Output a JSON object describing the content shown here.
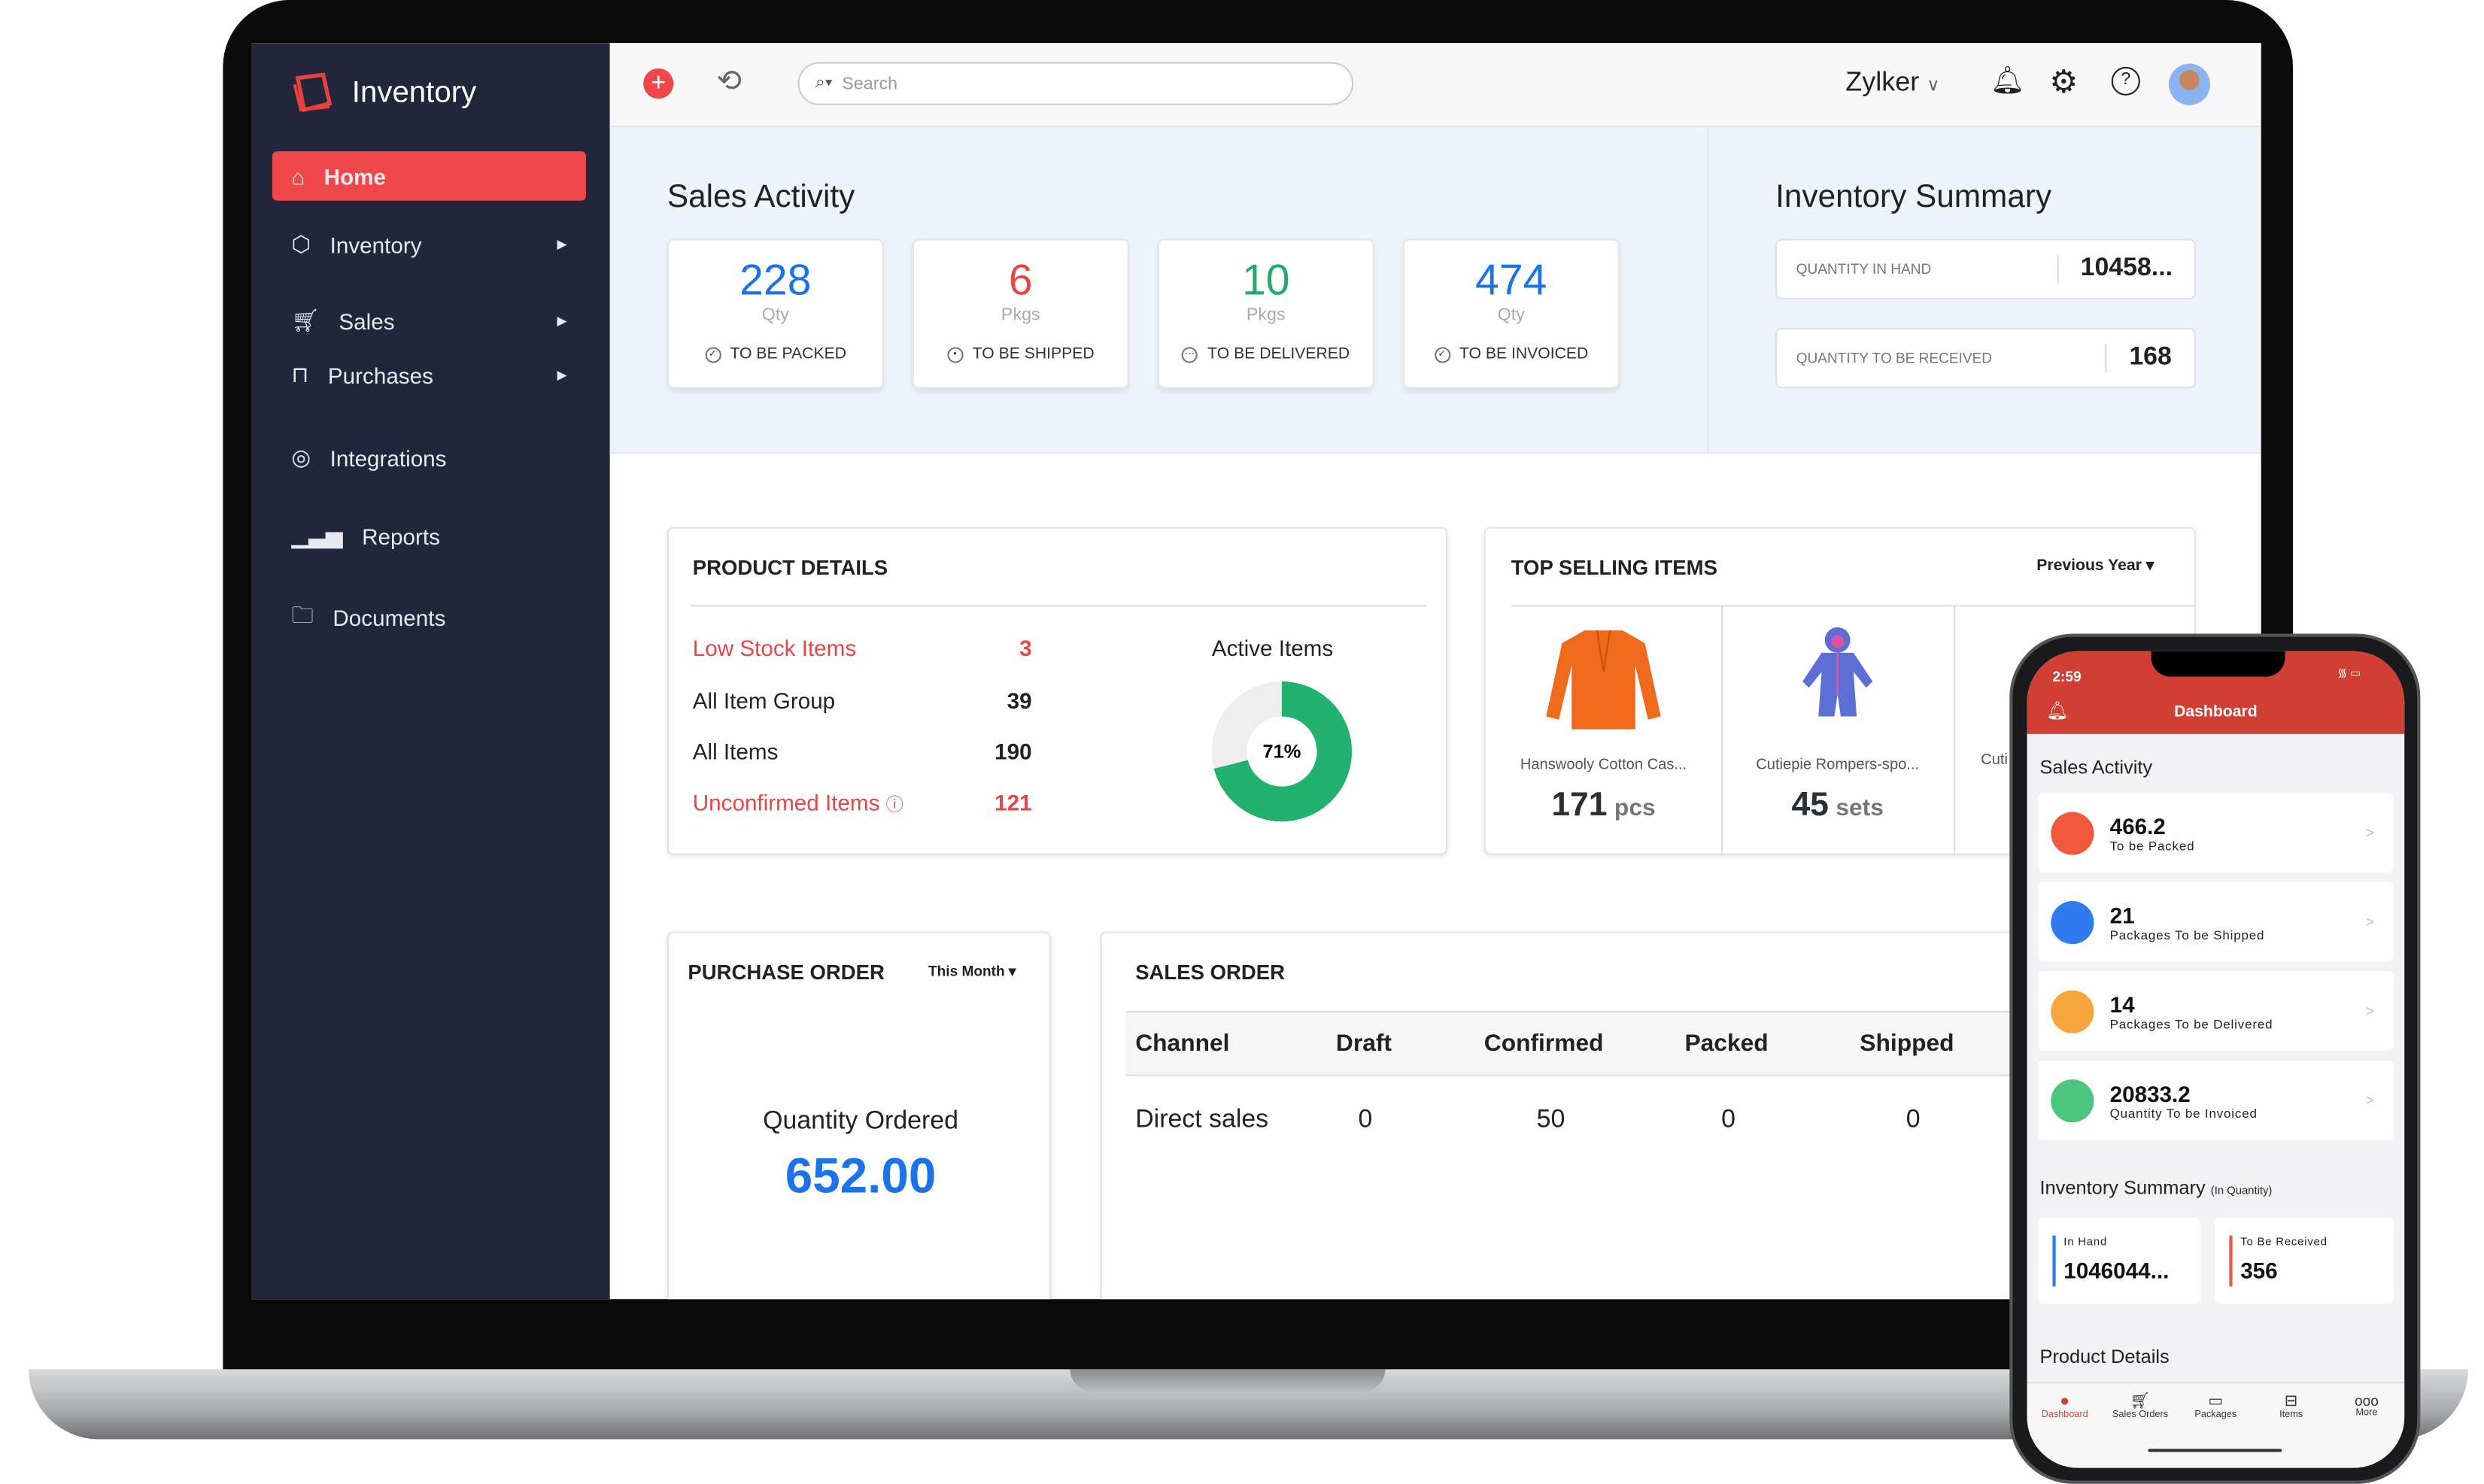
{
  "app": {
    "title": "Inventory"
  },
  "sidebar": {
    "items": [
      {
        "label": "Home",
        "icon": "home-icon",
        "active": true
      },
      {
        "label": "Inventory",
        "icon": "box-icon"
      },
      {
        "label": "Sales",
        "icon": "cart-icon"
      },
      {
        "label": "Purchases",
        "icon": "bag-icon"
      },
      {
        "label": "Integrations",
        "icon": "integrations-icon"
      },
      {
        "label": "Reports",
        "icon": "bar-chart-icon"
      },
      {
        "label": "Documents",
        "icon": "folder-icon"
      }
    ]
  },
  "topbar": {
    "search_placeholder": "Search",
    "org": "Zylker"
  },
  "sales_activity": {
    "title": "Sales Activity",
    "cards": [
      {
        "value": "228",
        "unit": "Qty",
        "label": "TO BE PACKED",
        "color": "#1a73e8"
      },
      {
        "value": "6",
        "unit": "Pkgs",
        "label": "TO BE SHIPPED",
        "color": "#e84545"
      },
      {
        "value": "10",
        "unit": "Pkgs",
        "label": "TO BE DELIVERED",
        "color": "#1fae6b"
      },
      {
        "value": "474",
        "unit": "Qty",
        "label": "TO BE INVOICED",
        "color": "#1a73e8"
      }
    ]
  },
  "inventory_summary": {
    "title": "Inventory Summary",
    "rows": [
      {
        "label": "QUANTITY IN HAND",
        "value": "10458..."
      },
      {
        "label": "QUANTITY TO BE RECEIVED",
        "value": "168"
      }
    ]
  },
  "product_details": {
    "title": "PRODUCT DETAILS",
    "rows": [
      {
        "label": "Low Stock Items",
        "value": "3",
        "alert": true
      },
      {
        "label": "All Item Group",
        "value": "39"
      },
      {
        "label": "All Items",
        "value": "190"
      },
      {
        "label": "Unconfirmed Items",
        "value": "121",
        "alert": true
      }
    ],
    "active_items_label": "Active Items",
    "active_percent": 71,
    "active_percent_label": "71%"
  },
  "top_selling": {
    "title": "TOP SELLING ITEMS",
    "filter": "Previous Year",
    "items": [
      {
        "name": "Hanswooly Cotton Cas...",
        "qty": "171",
        "unit": "pcs"
      },
      {
        "name": "Cutiepie Rompers-spo...",
        "qty": "45",
        "unit": "sets"
      },
      {
        "name": "Cuti"
      }
    ]
  },
  "purchase_order": {
    "title": "PURCHASE ORDER",
    "filter": "This Month",
    "label": "Quantity Ordered",
    "value": "652.00"
  },
  "sales_order": {
    "title": "SALES ORDER",
    "columns": [
      "Channel",
      "Draft",
      "Confirmed",
      "Packed",
      "Shipped"
    ],
    "rows": [
      [
        "Direct sales",
        "0",
        "50",
        "0",
        "0"
      ]
    ]
  },
  "phone": {
    "time": "2:59",
    "title": "Dashboard",
    "sales_title": "Sales Activity",
    "items": [
      {
        "value": "466.2",
        "label": "To be Packed",
        "color": "#f2593a"
      },
      {
        "value": "21",
        "label": "Packages To be Shipped",
        "color": "#2f7cf0"
      },
      {
        "value": "14",
        "label": "Packages To be Delivered",
        "color": "#f6a63c"
      },
      {
        "value": "20833.2",
        "label": "Quantity To be Invoiced",
        "color": "#4cc57f"
      }
    ],
    "inv_title": "Inventory Summary",
    "inv_sub": "(In Quantity)",
    "in_hand_label": "In Hand",
    "in_hand": "1046044...",
    "to_receive_label": "To Be Received",
    "to_receive": "356",
    "product_title": "Product Details",
    "tabs": [
      "Dashboard",
      "Sales Orders",
      "Packages",
      "Items",
      "More"
    ]
  }
}
